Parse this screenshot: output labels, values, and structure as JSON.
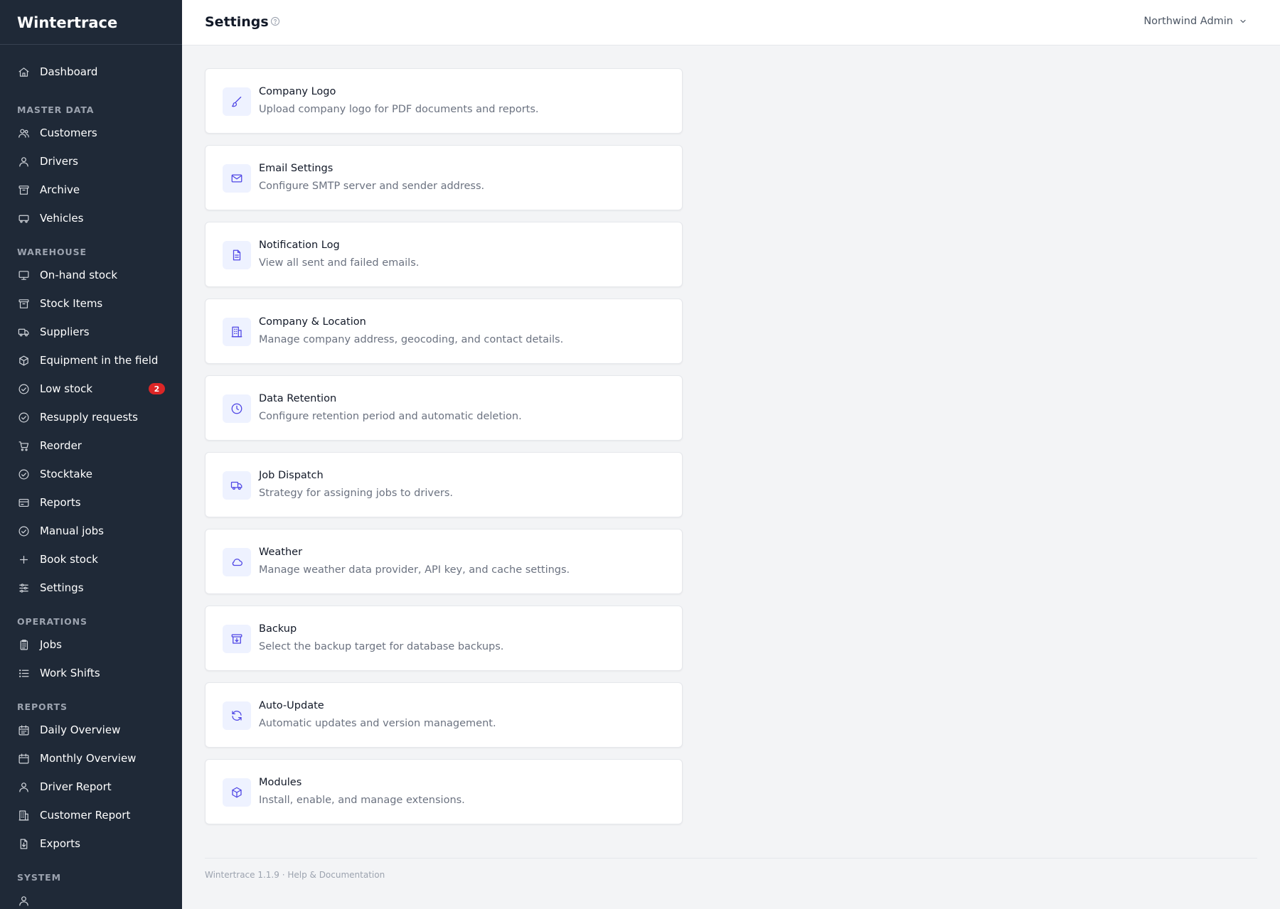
{
  "app": {
    "name": "Wintertrace"
  },
  "header": {
    "title": "Settings",
    "user": "Northwind Admin"
  },
  "sidebar": {
    "items": [
      {
        "type": "item",
        "key": "dashboard",
        "label": "Dashboard",
        "icon": "home-icon"
      },
      {
        "type": "section",
        "key": "master-data",
        "label": "MASTER DATA"
      },
      {
        "type": "item",
        "key": "customers",
        "label": "Customers",
        "icon": "users-icon"
      },
      {
        "type": "item",
        "key": "drivers",
        "label": "Drivers",
        "icon": "user-icon"
      },
      {
        "type": "item",
        "key": "archive",
        "label": "Archive",
        "icon": "archive-icon"
      },
      {
        "type": "item",
        "key": "vehicles",
        "label": "Vehicles",
        "icon": "van-icon"
      },
      {
        "type": "section",
        "key": "warehouse",
        "label": "WAREHOUSE"
      },
      {
        "type": "item",
        "key": "on-hand-stock",
        "label": "On-hand stock",
        "icon": "monitor-icon"
      },
      {
        "type": "item",
        "key": "stock-items",
        "label": "Stock Items",
        "icon": "archive-icon"
      },
      {
        "type": "item",
        "key": "suppliers",
        "label": "Suppliers",
        "icon": "truck-icon"
      },
      {
        "type": "item",
        "key": "equipment",
        "label": "Equipment in the field",
        "icon": "cube-icon"
      },
      {
        "type": "item",
        "key": "low-stock",
        "label": "Low stock",
        "icon": "check-circle-icon",
        "badge": "2"
      },
      {
        "type": "item",
        "key": "resupply",
        "label": "Resupply requests",
        "icon": "check-circle-icon"
      },
      {
        "type": "item",
        "key": "reorder",
        "label": "Reorder",
        "icon": "cart-icon"
      },
      {
        "type": "item",
        "key": "stocktake",
        "label": "Stocktake",
        "icon": "check-circle-icon"
      },
      {
        "type": "item",
        "key": "reports",
        "label": "Reports",
        "icon": "credit-card-icon"
      },
      {
        "type": "item",
        "key": "manual-jobs",
        "label": "Manual jobs",
        "icon": "check-circle-icon"
      },
      {
        "type": "item",
        "key": "book-stock",
        "label": "Book stock",
        "icon": "plus-icon"
      },
      {
        "type": "item",
        "key": "settings",
        "label": "Settings",
        "icon": "sliders-icon"
      },
      {
        "type": "section",
        "key": "operations",
        "label": "OPERATIONS"
      },
      {
        "type": "item",
        "key": "jobs",
        "label": "Jobs",
        "icon": "clipboard-icon"
      },
      {
        "type": "item",
        "key": "work-shifts",
        "label": "Work Shifts",
        "icon": "list-icon"
      },
      {
        "type": "section",
        "key": "reports-section",
        "label": "REPORTS"
      },
      {
        "type": "item",
        "key": "daily-overview",
        "label": "Daily Overview",
        "icon": "calendar-days-icon"
      },
      {
        "type": "item",
        "key": "monthly-overview",
        "label": "Monthly Overview",
        "icon": "calendar-icon"
      },
      {
        "type": "item",
        "key": "driver-report",
        "label": "Driver Report",
        "icon": "user-icon"
      },
      {
        "type": "item",
        "key": "customer-report",
        "label": "Customer Report",
        "icon": "building-icon"
      },
      {
        "type": "item",
        "key": "exports",
        "label": "Exports",
        "icon": "file-download-icon"
      },
      {
        "type": "section",
        "key": "system",
        "label": "SYSTEM"
      },
      {
        "type": "item",
        "key": "system-users",
        "label": "",
        "icon": "user-icon"
      }
    ]
  },
  "cards": [
    {
      "key": "company-logo",
      "title": "Company Logo",
      "description": "Upload company logo for PDF documents and reports.",
      "icon": "brush-icon"
    },
    {
      "key": "email-settings",
      "title": "Email Settings",
      "description": "Configure SMTP server and sender address.",
      "icon": "envelope-icon"
    },
    {
      "key": "notification-log",
      "title": "Notification Log",
      "description": "View all sent and failed emails.",
      "icon": "document-icon"
    },
    {
      "key": "company-location",
      "title": "Company & Location",
      "description": "Manage company address, geocoding, and contact details.",
      "icon": "building-icon"
    },
    {
      "key": "data-retention",
      "title": "Data Retention",
      "description": "Configure retention period and automatic deletion.",
      "icon": "clock-icon"
    },
    {
      "key": "job-dispatch",
      "title": "Job Dispatch",
      "description": "Strategy for assigning jobs to drivers.",
      "icon": "truck-icon"
    },
    {
      "key": "weather",
      "title": "Weather",
      "description": "Manage weather data provider, API key, and cache settings.",
      "icon": "cloud-icon"
    },
    {
      "key": "backup",
      "title": "Backup",
      "description": "Select the backup target for database backups.",
      "icon": "archive-download-icon"
    },
    {
      "key": "auto-update",
      "title": "Auto-Update",
      "description": "Automatic updates and version management.",
      "icon": "refresh-icon"
    },
    {
      "key": "modules",
      "title": "Modules",
      "description": "Install, enable, and manage extensions.",
      "icon": "cube-icon"
    }
  ],
  "footer": {
    "version": "Wintertrace 1.1.9",
    "separator": " · ",
    "help_link": "Help & Documentation"
  },
  "colors": {
    "sidebar_bg": "#1f2937",
    "accent": "#4f46e5",
    "icon_bg": "#eef2ff",
    "badge": "#dc2626",
    "page_bg": "#f3f4f6"
  }
}
